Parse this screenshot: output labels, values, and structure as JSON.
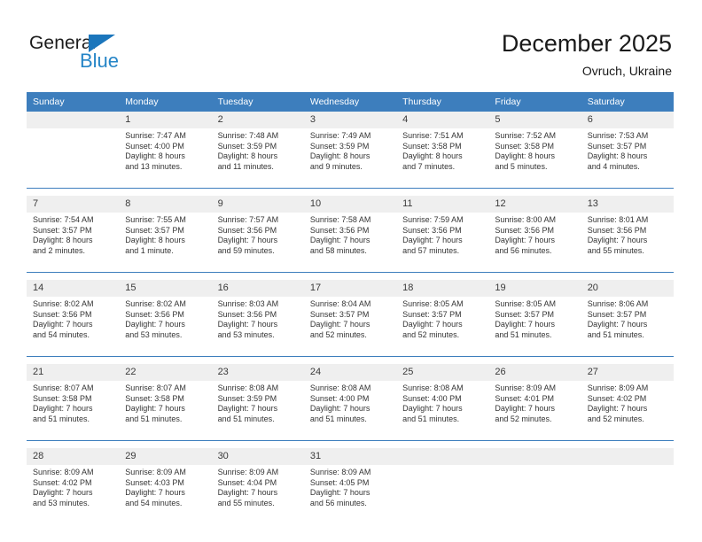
{
  "brand": {
    "name_part1": "General",
    "name_part2": "Blue",
    "triangle_color": "#1b76bc",
    "blue_text_color": "#2585c7"
  },
  "header": {
    "title": "December 2025",
    "subtitle": "Ovruch, Ukraine"
  },
  "theme": {
    "header_blue": "#3d7ebd",
    "daynum_band": "#efefef",
    "text": "#343434"
  },
  "calendar": {
    "weekday_headers": [
      "Sunday",
      "Monday",
      "Tuesday",
      "Wednesday",
      "Thursday",
      "Friday",
      "Saturday"
    ],
    "weeks": [
      {
        "days": [
          {
            "num": "",
            "sunrise": "",
            "sunset": "",
            "daylight_line1": "",
            "daylight_line2": ""
          },
          {
            "num": "1",
            "sunrise": "Sunrise: 7:47 AM",
            "sunset": "Sunset: 4:00 PM",
            "daylight_line1": "Daylight: 8 hours",
            "daylight_line2": "and 13 minutes."
          },
          {
            "num": "2",
            "sunrise": "Sunrise: 7:48 AM",
            "sunset": "Sunset: 3:59 PM",
            "daylight_line1": "Daylight: 8 hours",
            "daylight_line2": "and 11 minutes."
          },
          {
            "num": "3",
            "sunrise": "Sunrise: 7:49 AM",
            "sunset": "Sunset: 3:59 PM",
            "daylight_line1": "Daylight: 8 hours",
            "daylight_line2": "and 9 minutes."
          },
          {
            "num": "4",
            "sunrise": "Sunrise: 7:51 AM",
            "sunset": "Sunset: 3:58 PM",
            "daylight_line1": "Daylight: 8 hours",
            "daylight_line2": "and 7 minutes."
          },
          {
            "num": "5",
            "sunrise": "Sunrise: 7:52 AM",
            "sunset": "Sunset: 3:58 PM",
            "daylight_line1": "Daylight: 8 hours",
            "daylight_line2": "and 5 minutes."
          },
          {
            "num": "6",
            "sunrise": "Sunrise: 7:53 AM",
            "sunset": "Sunset: 3:57 PM",
            "daylight_line1": "Daylight: 8 hours",
            "daylight_line2": "and 4 minutes."
          }
        ]
      },
      {
        "days": [
          {
            "num": "7",
            "sunrise": "Sunrise: 7:54 AM",
            "sunset": "Sunset: 3:57 PM",
            "daylight_line1": "Daylight: 8 hours",
            "daylight_line2": "and 2 minutes."
          },
          {
            "num": "8",
            "sunrise": "Sunrise: 7:55 AM",
            "sunset": "Sunset: 3:57 PM",
            "daylight_line1": "Daylight: 8 hours",
            "daylight_line2": "and 1 minute."
          },
          {
            "num": "9",
            "sunrise": "Sunrise: 7:57 AM",
            "sunset": "Sunset: 3:56 PM",
            "daylight_line1": "Daylight: 7 hours",
            "daylight_line2": "and 59 minutes."
          },
          {
            "num": "10",
            "sunrise": "Sunrise: 7:58 AM",
            "sunset": "Sunset: 3:56 PM",
            "daylight_line1": "Daylight: 7 hours",
            "daylight_line2": "and 58 minutes."
          },
          {
            "num": "11",
            "sunrise": "Sunrise: 7:59 AM",
            "sunset": "Sunset: 3:56 PM",
            "daylight_line1": "Daylight: 7 hours",
            "daylight_line2": "and 57 minutes."
          },
          {
            "num": "12",
            "sunrise": "Sunrise: 8:00 AM",
            "sunset": "Sunset: 3:56 PM",
            "daylight_line1": "Daylight: 7 hours",
            "daylight_line2": "and 56 minutes."
          },
          {
            "num": "13",
            "sunrise": "Sunrise: 8:01 AM",
            "sunset": "Sunset: 3:56 PM",
            "daylight_line1": "Daylight: 7 hours",
            "daylight_line2": "and 55 minutes."
          }
        ]
      },
      {
        "days": [
          {
            "num": "14",
            "sunrise": "Sunrise: 8:02 AM",
            "sunset": "Sunset: 3:56 PM",
            "daylight_line1": "Daylight: 7 hours",
            "daylight_line2": "and 54 minutes."
          },
          {
            "num": "15",
            "sunrise": "Sunrise: 8:02 AM",
            "sunset": "Sunset: 3:56 PM",
            "daylight_line1": "Daylight: 7 hours",
            "daylight_line2": "and 53 minutes."
          },
          {
            "num": "16",
            "sunrise": "Sunrise: 8:03 AM",
            "sunset": "Sunset: 3:56 PM",
            "daylight_line1": "Daylight: 7 hours",
            "daylight_line2": "and 53 minutes."
          },
          {
            "num": "17",
            "sunrise": "Sunrise: 8:04 AM",
            "sunset": "Sunset: 3:57 PM",
            "daylight_line1": "Daylight: 7 hours",
            "daylight_line2": "and 52 minutes."
          },
          {
            "num": "18",
            "sunrise": "Sunrise: 8:05 AM",
            "sunset": "Sunset: 3:57 PM",
            "daylight_line1": "Daylight: 7 hours",
            "daylight_line2": "and 52 minutes."
          },
          {
            "num": "19",
            "sunrise": "Sunrise: 8:05 AM",
            "sunset": "Sunset: 3:57 PM",
            "daylight_line1": "Daylight: 7 hours",
            "daylight_line2": "and 51 minutes."
          },
          {
            "num": "20",
            "sunrise": "Sunrise: 8:06 AM",
            "sunset": "Sunset: 3:57 PM",
            "daylight_line1": "Daylight: 7 hours",
            "daylight_line2": "and 51 minutes."
          }
        ]
      },
      {
        "days": [
          {
            "num": "21",
            "sunrise": "Sunrise: 8:07 AM",
            "sunset": "Sunset: 3:58 PM",
            "daylight_line1": "Daylight: 7 hours",
            "daylight_line2": "and 51 minutes."
          },
          {
            "num": "22",
            "sunrise": "Sunrise: 8:07 AM",
            "sunset": "Sunset: 3:58 PM",
            "daylight_line1": "Daylight: 7 hours",
            "daylight_line2": "and 51 minutes."
          },
          {
            "num": "23",
            "sunrise": "Sunrise: 8:08 AM",
            "sunset": "Sunset: 3:59 PM",
            "daylight_line1": "Daylight: 7 hours",
            "daylight_line2": "and 51 minutes."
          },
          {
            "num": "24",
            "sunrise": "Sunrise: 8:08 AM",
            "sunset": "Sunset: 4:00 PM",
            "daylight_line1": "Daylight: 7 hours",
            "daylight_line2": "and 51 minutes."
          },
          {
            "num": "25",
            "sunrise": "Sunrise: 8:08 AM",
            "sunset": "Sunset: 4:00 PM",
            "daylight_line1": "Daylight: 7 hours",
            "daylight_line2": "and 51 minutes."
          },
          {
            "num": "26",
            "sunrise": "Sunrise: 8:09 AM",
            "sunset": "Sunset: 4:01 PM",
            "daylight_line1": "Daylight: 7 hours",
            "daylight_line2": "and 52 minutes."
          },
          {
            "num": "27",
            "sunrise": "Sunrise: 8:09 AM",
            "sunset": "Sunset: 4:02 PM",
            "daylight_line1": "Daylight: 7 hours",
            "daylight_line2": "and 52 minutes."
          }
        ]
      },
      {
        "days": [
          {
            "num": "28",
            "sunrise": "Sunrise: 8:09 AM",
            "sunset": "Sunset: 4:02 PM",
            "daylight_line1": "Daylight: 7 hours",
            "daylight_line2": "and 53 minutes."
          },
          {
            "num": "29",
            "sunrise": "Sunrise: 8:09 AM",
            "sunset": "Sunset: 4:03 PM",
            "daylight_line1": "Daylight: 7 hours",
            "daylight_line2": "and 54 minutes."
          },
          {
            "num": "30",
            "sunrise": "Sunrise: 8:09 AM",
            "sunset": "Sunset: 4:04 PM",
            "daylight_line1": "Daylight: 7 hours",
            "daylight_line2": "and 55 minutes."
          },
          {
            "num": "31",
            "sunrise": "Sunrise: 8:09 AM",
            "sunset": "Sunset: 4:05 PM",
            "daylight_line1": "Daylight: 7 hours",
            "daylight_line2": "and 56 minutes."
          },
          {
            "num": "",
            "sunrise": "",
            "sunset": "",
            "daylight_line1": "",
            "daylight_line2": ""
          },
          {
            "num": "",
            "sunrise": "",
            "sunset": "",
            "daylight_line1": "",
            "daylight_line2": ""
          },
          {
            "num": "",
            "sunrise": "",
            "sunset": "",
            "daylight_line1": "",
            "daylight_line2": ""
          }
        ]
      }
    ]
  }
}
